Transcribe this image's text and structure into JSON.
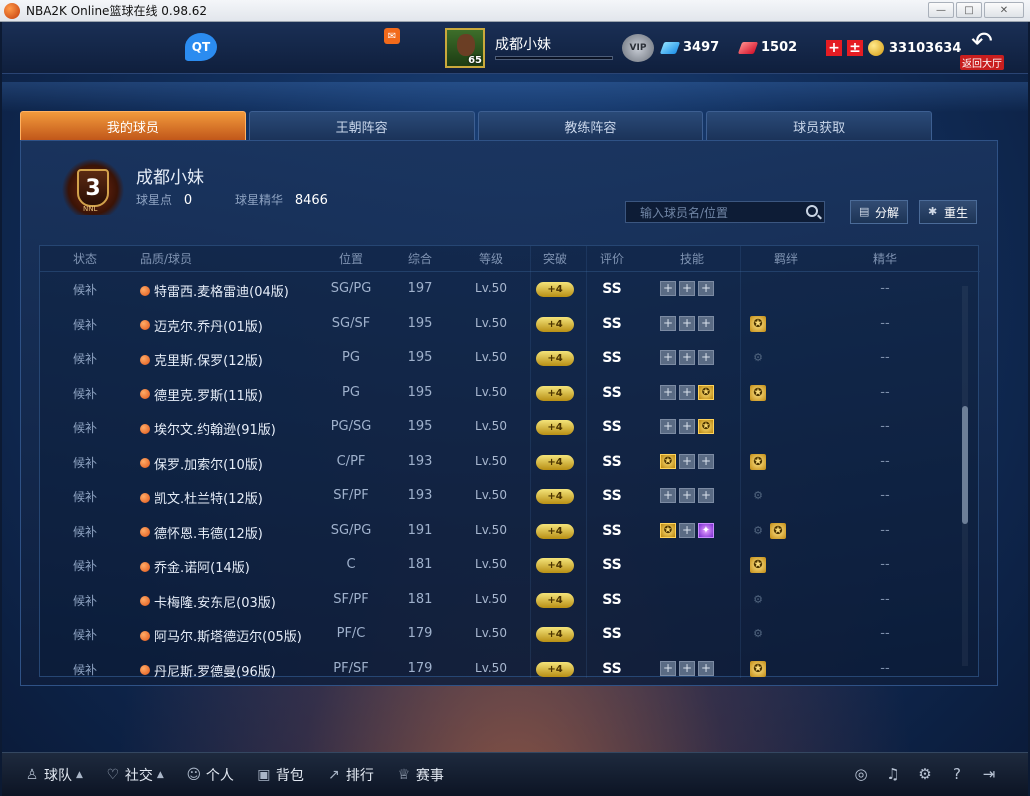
{
  "window": {
    "title": "NBA2K Online篮球在线 0.98.62",
    "controls": [
      "—",
      "□",
      "✕"
    ]
  },
  "topbar": {
    "qt_label": "QT",
    "player_level": "65",
    "player_name": "成都小妹",
    "vip_label": "VIP",
    "diamonds": "3497",
    "rubies": "1502",
    "coins": "33103634",
    "back_label": "返回大厅"
  },
  "tabs": [
    "我的球员",
    "王朝阵容",
    "教练阵容",
    "球员获取"
  ],
  "profile": {
    "rank_number": "3",
    "rank_tag": "NNL",
    "team_name": "成都小妹",
    "star_points_label": "球星点",
    "star_points": "0",
    "essence_label": "球星精华",
    "essence": "8466"
  },
  "search": {
    "placeholder": "输入球员名/位置"
  },
  "buttons": {
    "decompose": "分解",
    "reborn": "重生"
  },
  "table": {
    "headers": [
      "状态",
      "品质/球员",
      "位置",
      "综合",
      "等级",
      "突破",
      "评价",
      "技能",
      "羁绊",
      "精华"
    ],
    "rows": [
      {
        "status": "候补",
        "name": "特雷西.麦格雷迪(04版)",
        "pos": "SG/PG",
        "ovr": "197",
        "lv": "Lv.50",
        "brk": "+4",
        "rate": "SS",
        "skills": [
          "+",
          "+",
          "+"
        ],
        "bonds": [],
        "ess": "--"
      },
      {
        "status": "候补",
        "name": "迈克尔.乔丹(01版)",
        "pos": "SG/SF",
        "ovr": "195",
        "lv": "Lv.50",
        "brk": "+4",
        "rate": "SS",
        "skills": [
          "+",
          "+",
          "+"
        ],
        "bonds": [
          "gold"
        ],
        "ess": "--"
      },
      {
        "status": "候补",
        "name": "克里斯.保罗(12版)",
        "pos": "PG",
        "ovr": "195",
        "lv": "Lv.50",
        "brk": "+4",
        "rate": "SS",
        "skills": [
          "+",
          "+",
          "+"
        ],
        "bonds": [
          "dim"
        ],
        "ess": "--"
      },
      {
        "status": "候补",
        "name": "德里克.罗斯(11版)",
        "pos": "PG",
        "ovr": "195",
        "lv": "Lv.50",
        "brk": "+4",
        "rate": "SS",
        "skills": [
          "+",
          "+",
          "gold"
        ],
        "bonds": [
          "gold"
        ],
        "ess": "--"
      },
      {
        "status": "候补",
        "name": "埃尔文.约翰逊(91版)",
        "pos": "PG/SG",
        "ovr": "195",
        "lv": "Lv.50",
        "brk": "+4",
        "rate": "SS",
        "skills": [
          "+",
          "+",
          "gold"
        ],
        "bonds": [],
        "ess": "--"
      },
      {
        "status": "候补",
        "name": "保罗.加索尔(10版)",
        "pos": "C/PF",
        "ovr": "193",
        "lv": "Lv.50",
        "brk": "+4",
        "rate": "SS",
        "skills": [
          "gold",
          "+",
          "+"
        ],
        "bonds": [
          "gold"
        ],
        "ess": "--"
      },
      {
        "status": "候补",
        "name": "凯文.杜兰特(12版)",
        "pos": "SF/PF",
        "ovr": "193",
        "lv": "Lv.50",
        "brk": "+4",
        "rate": "SS",
        "skills": [
          "+",
          "+",
          "+"
        ],
        "bonds": [
          "dim"
        ],
        "ess": "--"
      },
      {
        "status": "候补",
        "name": "德怀恩.韦德(12版)",
        "pos": "SG/PG",
        "ovr": "191",
        "lv": "Lv.50",
        "brk": "+4",
        "rate": "SS",
        "skills": [
          "gold",
          "+",
          "purple"
        ],
        "bonds": [
          "dim",
          "gold"
        ],
        "ess": "--"
      },
      {
        "status": "候补",
        "name": "乔金.诺阿(14版)",
        "pos": "C",
        "ovr": "181",
        "lv": "Lv.50",
        "brk": "+4",
        "rate": "SS",
        "skills": [],
        "bonds": [
          "gold"
        ],
        "ess": "--"
      },
      {
        "status": "候补",
        "name": "卡梅隆.安东尼(03版)",
        "pos": "SF/PF",
        "ovr": "181",
        "lv": "Lv.50",
        "brk": "+4",
        "rate": "SS",
        "skills": [],
        "bonds": [
          "dim"
        ],
        "ess": "--"
      },
      {
        "status": "候补",
        "name": "阿马尔.斯塔德迈尔(05版)",
        "pos": "PF/C",
        "ovr": "179",
        "lv": "Lv.50",
        "brk": "+4",
        "rate": "SS",
        "skills": [],
        "bonds": [
          "dim"
        ],
        "ess": "--"
      },
      {
        "status": "候补",
        "name": "丹尼斯.罗德曼(96版)",
        "pos": "PF/SF",
        "ovr": "179",
        "lv": "Lv.50",
        "brk": "+4",
        "rate": "SS",
        "skills": [
          "+",
          "+",
          "+"
        ],
        "bonds": [
          "gold"
        ],
        "ess": "--"
      }
    ]
  },
  "bottom_nav": [
    {
      "label": "球队",
      "icon": "person-icon",
      "caret": true
    },
    {
      "label": "社交",
      "icon": "heart-icon",
      "caret": true
    },
    {
      "label": "个人",
      "icon": "user-icon",
      "caret": false
    },
    {
      "label": "背包",
      "icon": "bag-icon",
      "caret": false
    },
    {
      "label": "排行",
      "icon": "ranking-icon",
      "caret": false
    },
    {
      "label": "赛事",
      "icon": "trophy-icon",
      "caret": false
    }
  ],
  "bottom_right_icons": [
    "headset-icon",
    "music-icon",
    "gear-icon",
    "help-icon",
    "exit-icon"
  ],
  "colors": {
    "accent_orange": "#e2701f",
    "gold": "#e8c24a",
    "panel_blue": "#1a345e"
  }
}
